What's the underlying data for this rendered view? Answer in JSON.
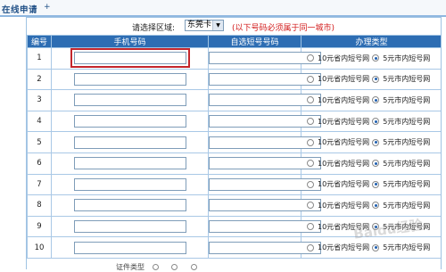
{
  "tabbar": {
    "title": "在线申请",
    "plus": "+"
  },
  "region": {
    "label": "请选择区域:",
    "selected": "东莞卡",
    "arrow_icon": "dropdown-arrow-icon",
    "note": "(以下号码必须属于同一城市)"
  },
  "table": {
    "headers": [
      "编号",
      "手机号码",
      "自选短号号码",
      "办理类型"
    ],
    "option_a": "10元省内短号网",
    "option_b": "5元市内短号网",
    "rows": [
      {
        "num": "1",
        "phone": "",
        "short": "",
        "selected": "option_b",
        "focused": true
      },
      {
        "num": "2",
        "phone": "",
        "short": "",
        "selected": "option_b"
      },
      {
        "num": "3",
        "phone": "",
        "short": "",
        "selected": "option_b"
      },
      {
        "num": "4",
        "phone": "",
        "short": "",
        "selected": "option_b"
      },
      {
        "num": "5",
        "phone": "",
        "short": "",
        "selected": "option_b"
      },
      {
        "num": "6",
        "phone": "",
        "short": "",
        "selected": "option_b"
      },
      {
        "num": "7",
        "phone": "",
        "short": "",
        "selected": "option_b"
      },
      {
        "num": "8",
        "phone": "",
        "short": "",
        "selected": "option_b"
      },
      {
        "num": "9",
        "phone": "",
        "short": "",
        "selected": "option_b"
      },
      {
        "num": "10",
        "phone": "",
        "short": "",
        "selected": "option_b"
      }
    ]
  },
  "footer": {
    "text": "证件类型"
  },
  "watermark": {
    "text": "Baidu经验"
  },
  "colors": {
    "header_bg": "#2d6db3",
    "border": "#a9c8e6",
    "note": "#d21a1a",
    "focus": "#c4262c"
  }
}
